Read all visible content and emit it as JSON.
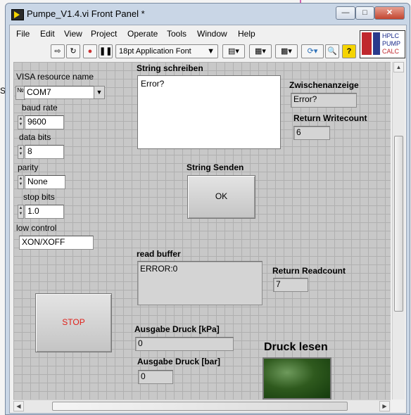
{
  "window": {
    "title": "Pumpe_V1.4.vi Front Panel *"
  },
  "menu": [
    "File",
    "Edit",
    "View",
    "Project",
    "Operate",
    "Tools",
    "Window",
    "Help"
  ],
  "toolbar": {
    "font": "18pt Application Font"
  },
  "logo": {
    "lines": [
      "HPLC",
      "PUMP",
      "CALC"
    ]
  },
  "background_window": {
    "fragment": "S"
  },
  "panel": {
    "visa": {
      "label": "VISA resource name",
      "value": "COM7"
    },
    "baud": {
      "label": "baud rate",
      "value": "9600"
    },
    "databits": {
      "label": "data bits",
      "value": "8"
    },
    "parity": {
      "label": "parity",
      "value": "None"
    },
    "stopbits": {
      "label": "stop bits",
      "value": "1.0"
    },
    "flow": {
      "label": "low control",
      "value": "XON/XOFF"
    },
    "string_write": {
      "label": "String schreiben",
      "value": "Error?"
    },
    "zwischen": {
      "label": "Zwischenanzeige",
      "value": "Error?"
    },
    "writecount": {
      "label": "Return Writecount",
      "value": "6"
    },
    "send": {
      "label": "String Senden",
      "button": "OK"
    },
    "readbuf": {
      "label": "read buffer",
      "value": "ERROR:0"
    },
    "readcount": {
      "label": "Return Readcount",
      "value": "7"
    },
    "stop": {
      "label": "STOP"
    },
    "druck_kpa": {
      "label": "Ausgabe Druck [kPa]",
      "value": "0"
    },
    "druck_bar": {
      "label": "Ausgabe Druck [bar]",
      "value": "0"
    },
    "druck_lesen": {
      "label": "Druck lesen"
    }
  }
}
